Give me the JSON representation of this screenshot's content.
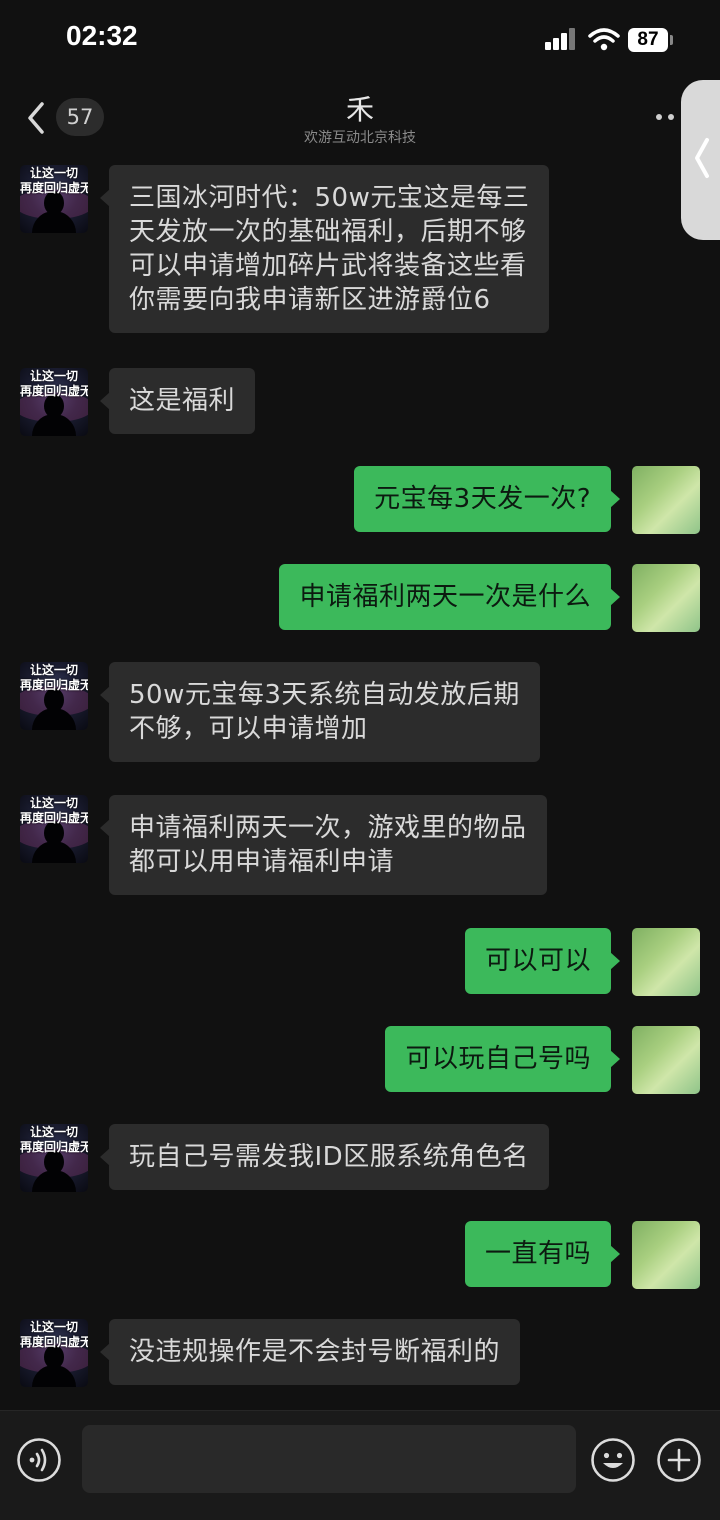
{
  "status_bar": {
    "time": "02:32",
    "battery": "87"
  },
  "header": {
    "unread_count": "57",
    "title": "禾",
    "subtitle": "欢游互动北京科技"
  },
  "avatar_caption": [
    "让这一切",
    "再度回归虚无"
  ],
  "messages": [
    {
      "side": "in",
      "text": "三国冰河时代：50w元宝这是每三\n天发放一次的基础福利，后期不够\n可以申请增加碎片武将装备这些看\n你需要向我申请新区进游爵位6"
    },
    {
      "side": "in",
      "text": "这是福利"
    },
    {
      "side": "out",
      "text": "元宝每3天发一次?"
    },
    {
      "side": "out",
      "text": "申请福利两天一次是什么"
    },
    {
      "side": "in",
      "text": "50w元宝每3天系统自动发放后期\n不够，可以申请增加"
    },
    {
      "side": "in",
      "text": "申请福利两天一次，游戏里的物品\n都可以用申请福利申请"
    },
    {
      "side": "out",
      "text": "可以可以"
    },
    {
      "side": "out",
      "text": "可以玩自己号吗"
    },
    {
      "side": "in",
      "text": "玩自己号需发我ID区服系统角色名"
    },
    {
      "side": "out",
      "text": "一直有吗"
    },
    {
      "side": "in",
      "text": "没违规操作是不会封号断福利的"
    }
  ],
  "input": {
    "placeholder": ""
  },
  "colors": {
    "outgoing_bubble": "#3cb95b",
    "incoming_bubble": "#2c2c2c",
    "background": "#111111"
  }
}
